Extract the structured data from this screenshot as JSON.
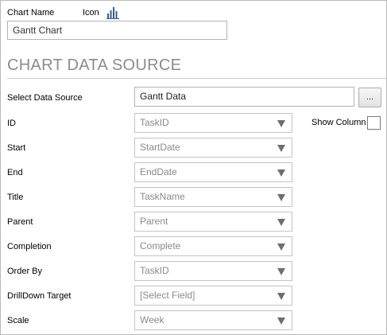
{
  "header": {
    "chart_name_label": "Chart Name",
    "icon_label": "Icon",
    "icon_name": "bar-chart-icon",
    "chart_name_value": "Gantt Chart"
  },
  "section": {
    "title": "CHART DATA SOURCE"
  },
  "data_source": {
    "label": "Select Data Source",
    "value": "Gantt Data",
    "browse_label": "..."
  },
  "show_column": {
    "label": "Show Column",
    "checked": false
  },
  "fields": [
    {
      "label": "ID",
      "value": "TaskID"
    },
    {
      "label": "Start",
      "value": "StartDate"
    },
    {
      "label": "End",
      "value": "EndDate"
    },
    {
      "label": "Title",
      "value": "TaskName"
    },
    {
      "label": "Parent",
      "value": "Parent"
    },
    {
      "label": "Completion",
      "value": "Complete"
    },
    {
      "label": "Order By",
      "value": "TaskID"
    },
    {
      "label": "DrillDown Target",
      "value": "[Select Field]"
    },
    {
      "label": "Scale",
      "value": "Week"
    }
  ],
  "colors": {
    "section_title": "#8c8c8c",
    "icon_fill": "#2f5f8f",
    "dropdown_text": "#8a8a8a"
  }
}
